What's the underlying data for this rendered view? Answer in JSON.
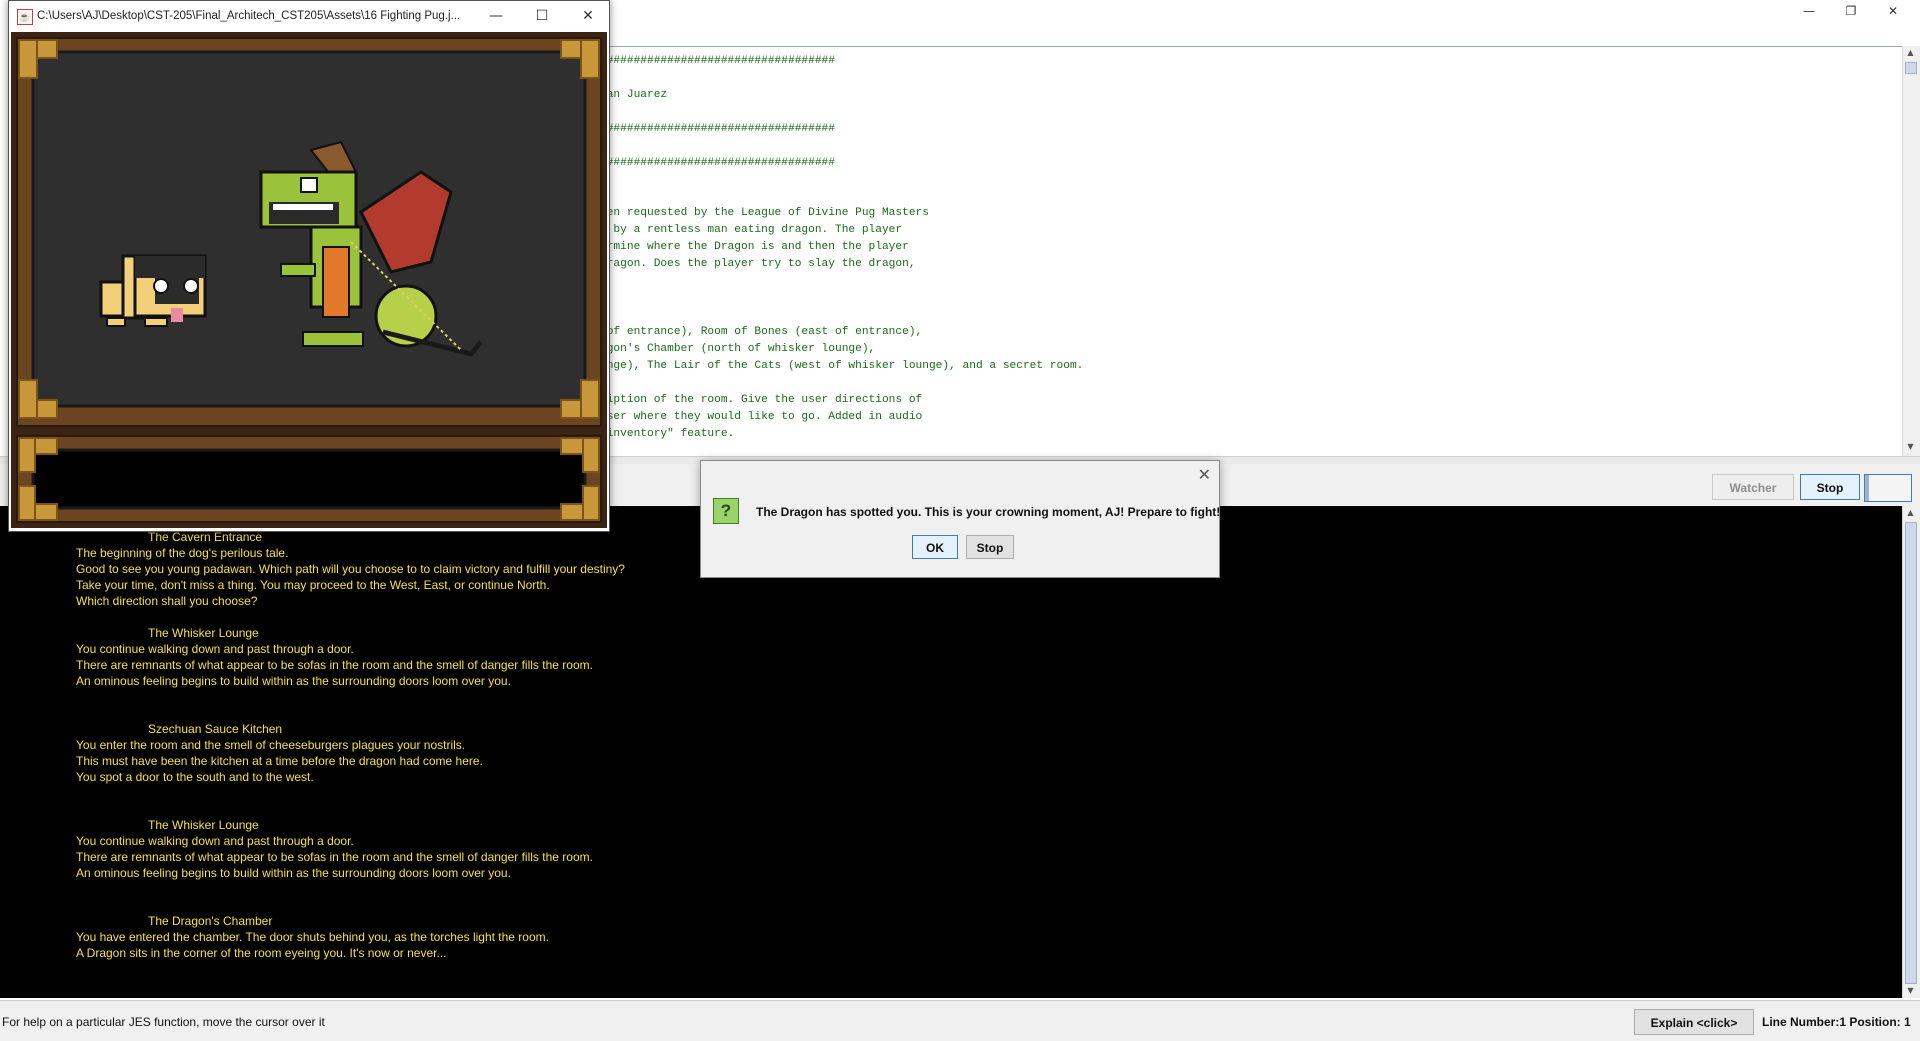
{
  "picture_window": {
    "title": "C:\\Users\\AJ\\Desktop\\CST-205\\Final_Architech_CST205\\Assets\\16 Fighting Pug.j...",
    "minimize": "—",
    "maximize": "☐",
    "close": "✕",
    "scene_colors": {
      "frame": "#b8862f",
      "board": "#2f2f2f",
      "pug": "#f3cf7a",
      "dragon": "#9bc23b",
      "wing": "#b23b2e"
    }
  },
  "main_window": {
    "minimize": "—",
    "restore": "❐",
    "close": "✕"
  },
  "editor": {
    "lines": [
      "###################################",
      "uan Juarez",
      "###################################",
      "###################################",
      "een requested by the League of Divine Pug Masters",
      "d by a rentless man eating dragon. The player",
      "ermine where the Dragon is and then the player",
      "dragon. Does the player try to slay the dragon,",
      " of entrance), Room of Bones (east of entrance),",
      "agon's Chamber (north of whisker lounge),",
      "unge), The Lair of the Cats (west of whisker lounge), and a secret room.",
      "ription of the room. Give the user directions of",
      "user where they would like to go. Added in audio",
      " inventory\" feature."
    ]
  },
  "toolbar": {
    "watcher": "Watcher",
    "stop": "Stop"
  },
  "console": {
    "blocks": [
      {
        "heading": "The Cavern Entrance",
        "lines": [
          "The beginning of the dog's perilous tale.",
          "Good to see you young padawan. Which path will you choose to to claim victory and fulfill your destiny?",
          "Take your time, don't miss a thing. You may proceed to the West, East, or continue North.",
          "Which direction shall you choose?"
        ]
      },
      {
        "heading": "The Whisker Lounge",
        "lines": [
          "You continue walking down and past through a door.",
          "There are remnants of what appear to be sofas in the room and the smell of danger fills the room.",
          "An ominous feeling begins to build within as the surrounding doors loom over you."
        ]
      },
      {
        "heading": "Szechuan Sauce Kitchen",
        "lines": [
          "You enter the room and the smell of cheeseburgers plagues your nostrils.",
          "This must have been the kitchen at a time before the dragon had come here.",
          "You spot a door to the south and to the west."
        ]
      },
      {
        "heading": "The Whisker Lounge",
        "lines": [
          "You continue walking down and past through a door.",
          "There are remnants of what appear to be sofas in the room and the smell of danger fills the room.",
          "An ominous feeling begins to build within as the surrounding doors loom over you."
        ]
      },
      {
        "heading": "The Dragon's Chamber",
        "lines": [
          "You have entered the chamber. The door shuts behind you, as the torches light the room.",
          "A Dragon sits in the corner of the room eyeing you. It's now or never..."
        ]
      }
    ]
  },
  "dialog": {
    "message": "The Dragon has spotted you. This is your crowning moment, AJ! Prepare to fight!",
    "ok": "OK",
    "stop": "Stop",
    "close": "✕",
    "icon": "?"
  },
  "status": {
    "help": "For help on a particular JES function, move the cursor over it",
    "explain": "Explain <click>",
    "position": "Line Number:1 Position: 1"
  }
}
